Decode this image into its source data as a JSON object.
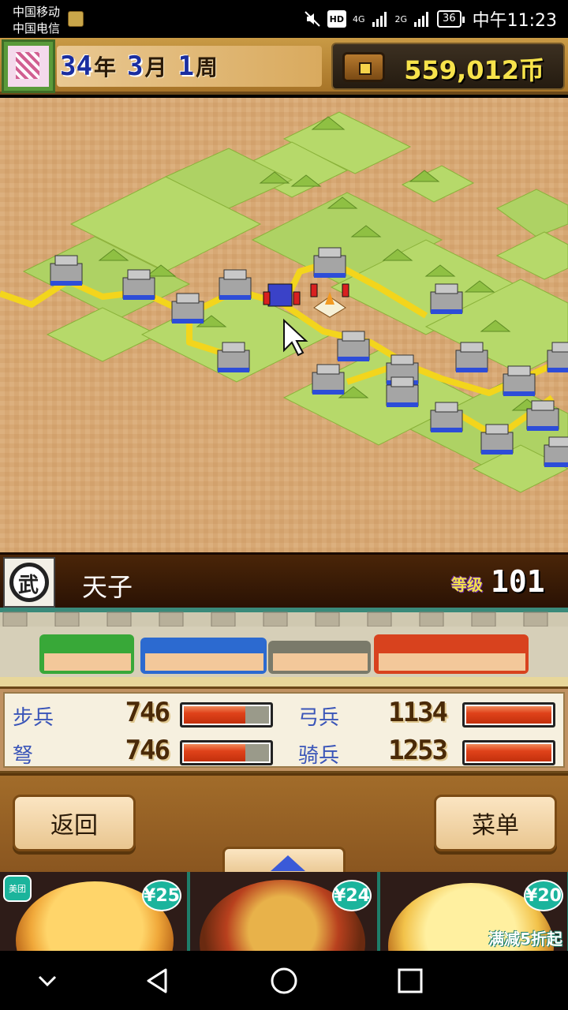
{
  "status_bar": {
    "carrier_1": "中国移动",
    "carrier_2": "中国电信",
    "network_1": "4G",
    "network_2": "2G",
    "hd": "HD",
    "battery": "36",
    "time": "中午11:23"
  },
  "header": {
    "year_value": "34",
    "year_label": "年",
    "month_value": "3",
    "month_label": "月",
    "week_value": "1",
    "week_label": "周",
    "money": "559,012币"
  },
  "lord": {
    "name": "天子",
    "level_label": "等级",
    "level_value": "101"
  },
  "stats": [
    {
      "label": "步兵",
      "value": "746",
      "fill": 0.72
    },
    {
      "label": "弓兵",
      "value": "1134",
      "fill": 1.0
    },
    {
      "label": "弩",
      "value": "746",
      "fill": 0.72
    },
    {
      "label": "骑兵",
      "value": "1253",
      "fill": 1.0
    }
  ],
  "buttons": {
    "back": "返回",
    "menu": "菜单"
  },
  "ads": {
    "brand": "美团",
    "prices": [
      "¥25",
      "¥24",
      "¥20"
    ],
    "promo": "满减5折起"
  },
  "colors": {
    "accent_gold": "#f7e34b",
    "date_blue": "#1a2ea0",
    "stat_label_blue": "#3a55b8",
    "bar_red": "#e0421a"
  },
  "icons": {
    "money": "treasure-chest-icon",
    "up": "triangle-up-icon",
    "nav_back": "triangle-left-icon",
    "nav_home": "circle-icon",
    "nav_recent": "square-icon",
    "nav_hide": "chevron-down-icon"
  }
}
